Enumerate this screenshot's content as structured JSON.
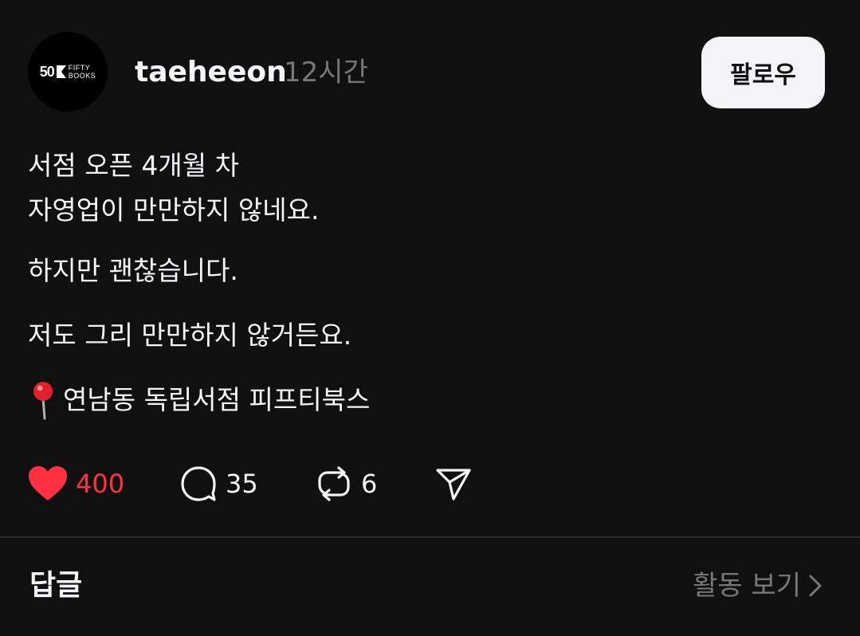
{
  "post": {
    "username": "taeheeon",
    "time": "12시간",
    "follow_label": "팔로우",
    "avatar": {
      "logo_mark": "50",
      "logo_line1": "FIFTY",
      "logo_line2": "BOOKS"
    },
    "paragraphs": [
      "서점 오픈 4개월 차\n자영업이 만만하지 않네요.",
      "하지만 괜찮습니다.",
      "저도 그리 만만하지 않거든요."
    ],
    "location_text": "연남동 독립서점 피프티북스",
    "likes": "400",
    "replies": "35",
    "reposts": "6",
    "like_color": "#ff3040"
  },
  "footer": {
    "replies_title": "답글",
    "activity_label": "활동 보기"
  }
}
